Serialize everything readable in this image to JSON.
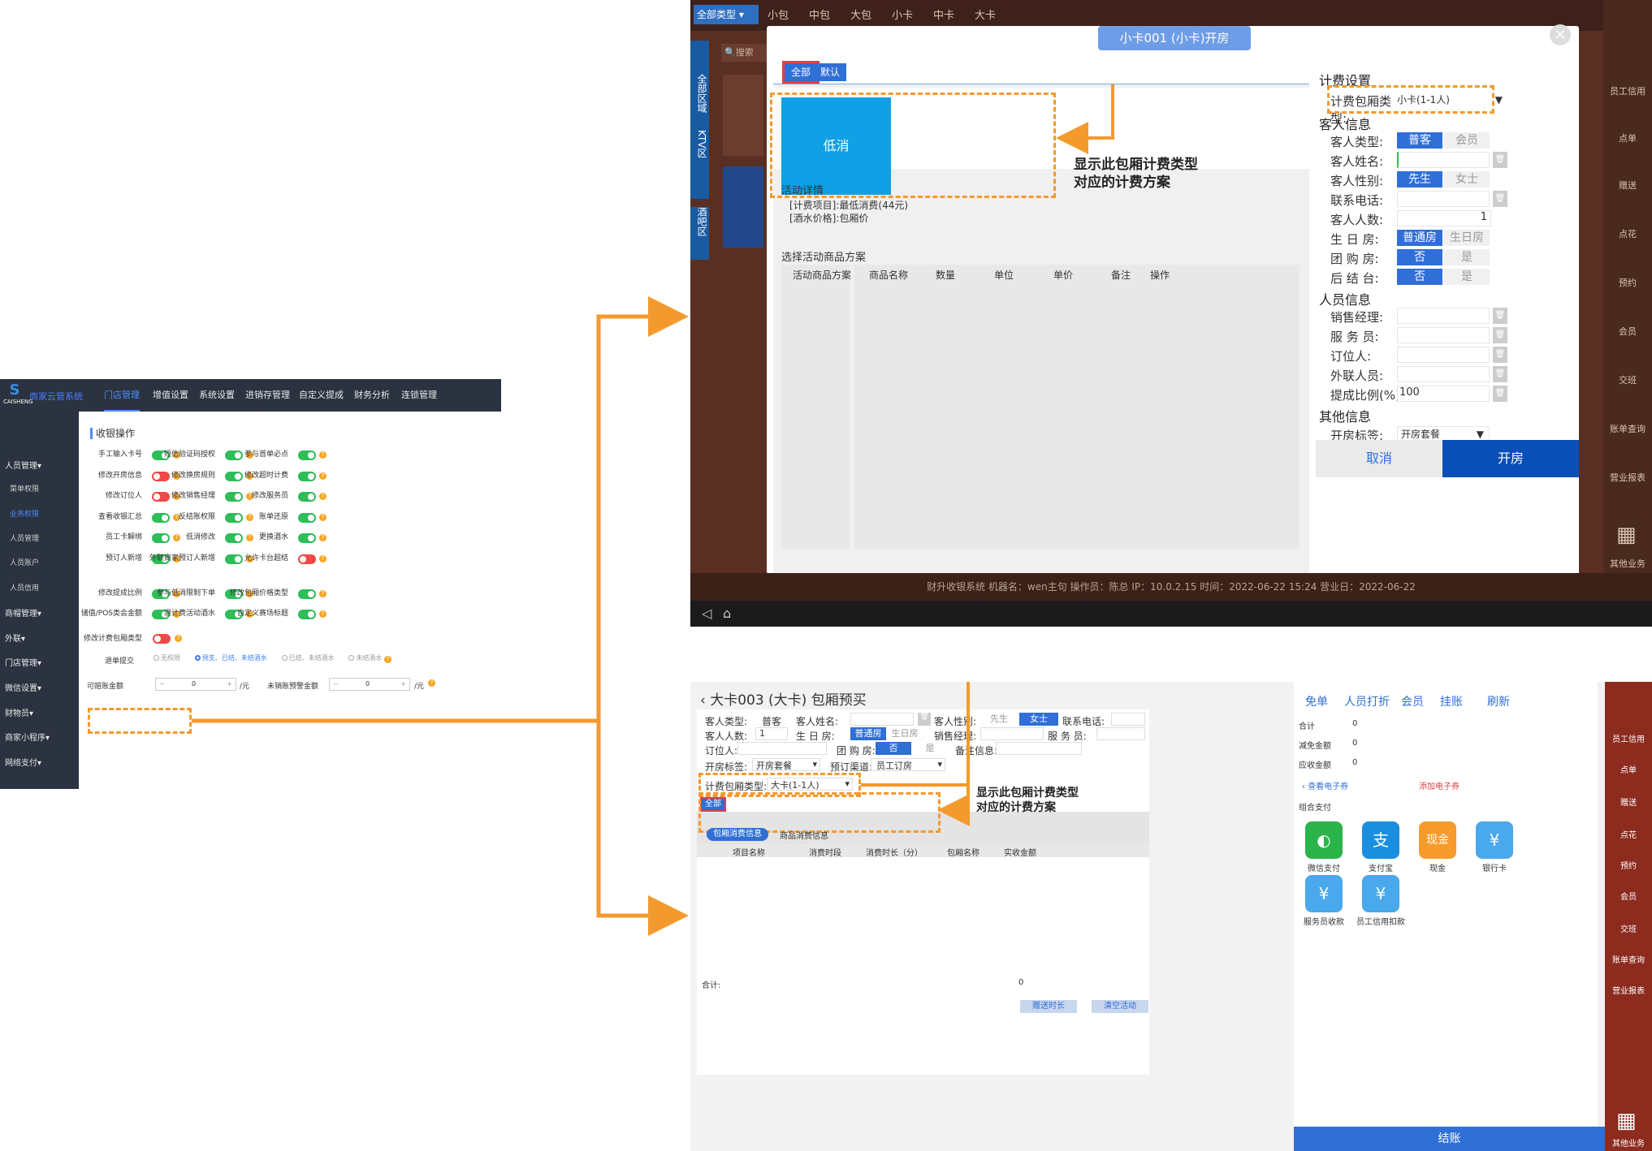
{
  "admin": {
    "brand": "商家云管系统",
    "logo_text": "CAISHENG",
    "nav": [
      "门店管理",
      "增值设置",
      "系统设置",
      "进销存管理",
      "自定义提成",
      "财务分析",
      "连锁管理"
    ],
    "side": [
      "人员管理▾",
      "菜单权限",
      "业务权限",
      "人员管理",
      "人员账户",
      "人员信用",
      "商帽管理▾",
      "外联▾",
      "门店管理▾",
      "微信设置▾",
      "财物员▾",
      "商家小程序▾",
      "网络支付▾"
    ],
    "section": "收银操作",
    "switches": [
      {
        "label": "手工输入卡号",
        "on": true
      },
      {
        "label": "短信验证码授权",
        "on": true
      },
      {
        "label": "参与首单必点",
        "on": true
      },
      {
        "label": "修改开房信息",
        "on": false
      },
      {
        "label": "修改换房规则",
        "on": true
      },
      {
        "label": "修改超时计费",
        "on": true
      },
      {
        "label": "修改订位人",
        "on": false
      },
      {
        "label": "修改销售经理",
        "on": true
      },
      {
        "label": "修改服务员",
        "on": true
      },
      {
        "label": "查看收银汇总",
        "on": true
      },
      {
        "label": "反结账权限",
        "on": true
      },
      {
        "label": "账单还原",
        "on": true
      },
      {
        "label": "员工卡解绑",
        "on": true
      },
      {
        "label": "低消修改",
        "on": true
      },
      {
        "label": "更换酒水",
        "on": true
      },
      {
        "label": "预订人新增",
        "on": true
      },
      {
        "label": "外联商家预订人新增",
        "on": true
      },
      {
        "label": "允许卡台超结",
        "on": false
      },
      {
        "label": "修改提成比例",
        "on": true
      },
      {
        "label": "参与低消限制下单",
        "on": true
      },
      {
        "label": "修改包厢价格类型",
        "on": true
      },
      {
        "label": "储值/POS类会金额",
        "on": true
      },
      {
        "label": "退计费活动酒水",
        "on": true
      },
      {
        "label": "自定义赛场标题",
        "on": true
      }
    ],
    "highlight_switch": {
      "label": "修改计费包厢类型",
      "on": false
    },
    "refund_label": "退单提交",
    "refund_options": [
      "无权限",
      "预支、已结、未结酒水",
      "已结、未结酒水",
      "未结酒水"
    ],
    "refund_selected": 1,
    "limit1_label": "可赔账金额",
    "limit1_value": "0",
    "limit1_unit": "/元",
    "limit2_label": "未销账预警金额",
    "limit2_value": "0",
    "limit2_unit": "/元"
  },
  "top": {
    "bar_dropdown": "全部类型 ▾",
    "bar_tabs": [
      "小包",
      "中包",
      "大包",
      "小卡",
      "中卡",
      "大卡"
    ],
    "search_placeholder": "搜索",
    "left_groups": [
      "全部区域",
      "KTV区",
      "酒吧区"
    ],
    "rail": [
      "员工信用",
      "点单",
      "赠送",
      "点花",
      "预约",
      "会员",
      "交班",
      "账单查询",
      "营业报表",
      "其他业务"
    ],
    "status_line": "财升收银系统    机器名：wen主句    操作员：陈总    IP：10.0.2.15    时间：2022-06-22 15:24    营业日：2022-06-22",
    "dialog": {
      "title": "小卡001 (小卡)开房",
      "tabs": [
        "全部",
        "默认"
      ],
      "plan": "低消",
      "detail_title": "活动详情",
      "detail_lines": [
        "[计费项目]:最低消费(44元)",
        "[酒水价格]:包厢价"
      ],
      "goods_title": "选择活动商品方案",
      "goods_cols": [
        "活动商品方案",
        "商品名称",
        "数量",
        "单位",
        "单价",
        "备注",
        "操作"
      ],
      "billing_section": "计费设置",
      "billing_label": "计费包厢类型:",
      "billing_value": "小卡(1-1人)",
      "guest_section": "客人信息",
      "guest_type_label": "客人类型:",
      "guest_type_on": "普客",
      "guest_type_off": "会员",
      "guest_name_label": "客人姓名:",
      "guest_gender_label": "客人性别:",
      "gender_on": "先生",
      "gender_off": "女士",
      "phone_label": "联系电话:",
      "count_label": "客人人数:",
      "count_value": "1",
      "birthday_label": "生 日 房:",
      "birthday_on": "普通房",
      "birthday_off": "生日房",
      "group_label": "团 购 房:",
      "group_on": "否",
      "group_off": "是",
      "post_label": "后 结 台:",
      "post_on": "否",
      "post_off": "是",
      "staff_section": "人员信息",
      "sales_label": "销售经理:",
      "waiter_label": "服 务 员:",
      "booker_label": "订位人:",
      "outside_label": "外联人员:",
      "ratio_label": "提成比例(%):",
      "ratio_value": "100",
      "other_section": "其他信息",
      "tag_label": "开房标签:",
      "tag_value": "开房套餐",
      "cancel": "取消",
      "open": "开房"
    },
    "note": [
      "显示此包厢计费类型",
      "对应的计费方案"
    ]
  },
  "bottom": {
    "title": "大卡003 (大卡) 包厢预买",
    "guest_type_label": "客人类型:",
    "guest_type_value": "普客",
    "guest_name_label": "客人姓名:",
    "gender_label": "客人性别:",
    "gender_off": "先生",
    "gender_on": "女士",
    "phone_label": "联系电话:",
    "count_label": "客人人数:",
    "count_value": "1",
    "birthday_label": "生 日 房:",
    "birthday_on": "普通房",
    "birthday_off": "生日房",
    "sales_label": "销售经理:",
    "waiter_label": "服 务 员:",
    "booker_label": "订位人:",
    "group_label": "团 购 房:",
    "group_on": "否",
    "group_off": "是",
    "remark_label": "备注信息:",
    "tag_label": "开房标签:",
    "tag_value": "开房套餐",
    "channel_label": "预订渠道:",
    "channel_value": "员工订房",
    "billing_label": "计费包厢类型:",
    "billing_value": "大卡(1-1人)",
    "tab_all": "全部",
    "sub_tabs": [
      "包厢消费信息",
      "商品消费信息"
    ],
    "table_cols": [
      "项目名称",
      "消费时段",
      "消费时长（分）",
      "包厢名称",
      "实收金额"
    ],
    "total_label": "合计:",
    "total_value": "0",
    "btn_gift": "赠送时长",
    "btn_clear": "清空活动",
    "pay_top": [
      "免单",
      "人员打折",
      "会员",
      "挂账",
      "刷新"
    ],
    "sum_rows": [
      [
        "合计",
        "0"
      ],
      [
        "减免金额",
        "0"
      ],
      [
        "应收金额",
        "0"
      ]
    ],
    "coupon_view": "查看电子券",
    "coupon_add": "添加电子券",
    "combo_pay": "组合支付",
    "pay_methods": [
      "微信支付",
      "支付宝",
      "现金",
      "银行卡",
      "服务员收款",
      "员工信用扣款"
    ],
    "rail": [
      "员工信用",
      "点单",
      "赠送",
      "点花",
      "预约",
      "会员",
      "交班",
      "账单查询",
      "营业报表",
      "其他业务"
    ],
    "checkout": "结账",
    "note": [
      "显示此包厢计费类型",
      "对应的计费方案"
    ]
  }
}
